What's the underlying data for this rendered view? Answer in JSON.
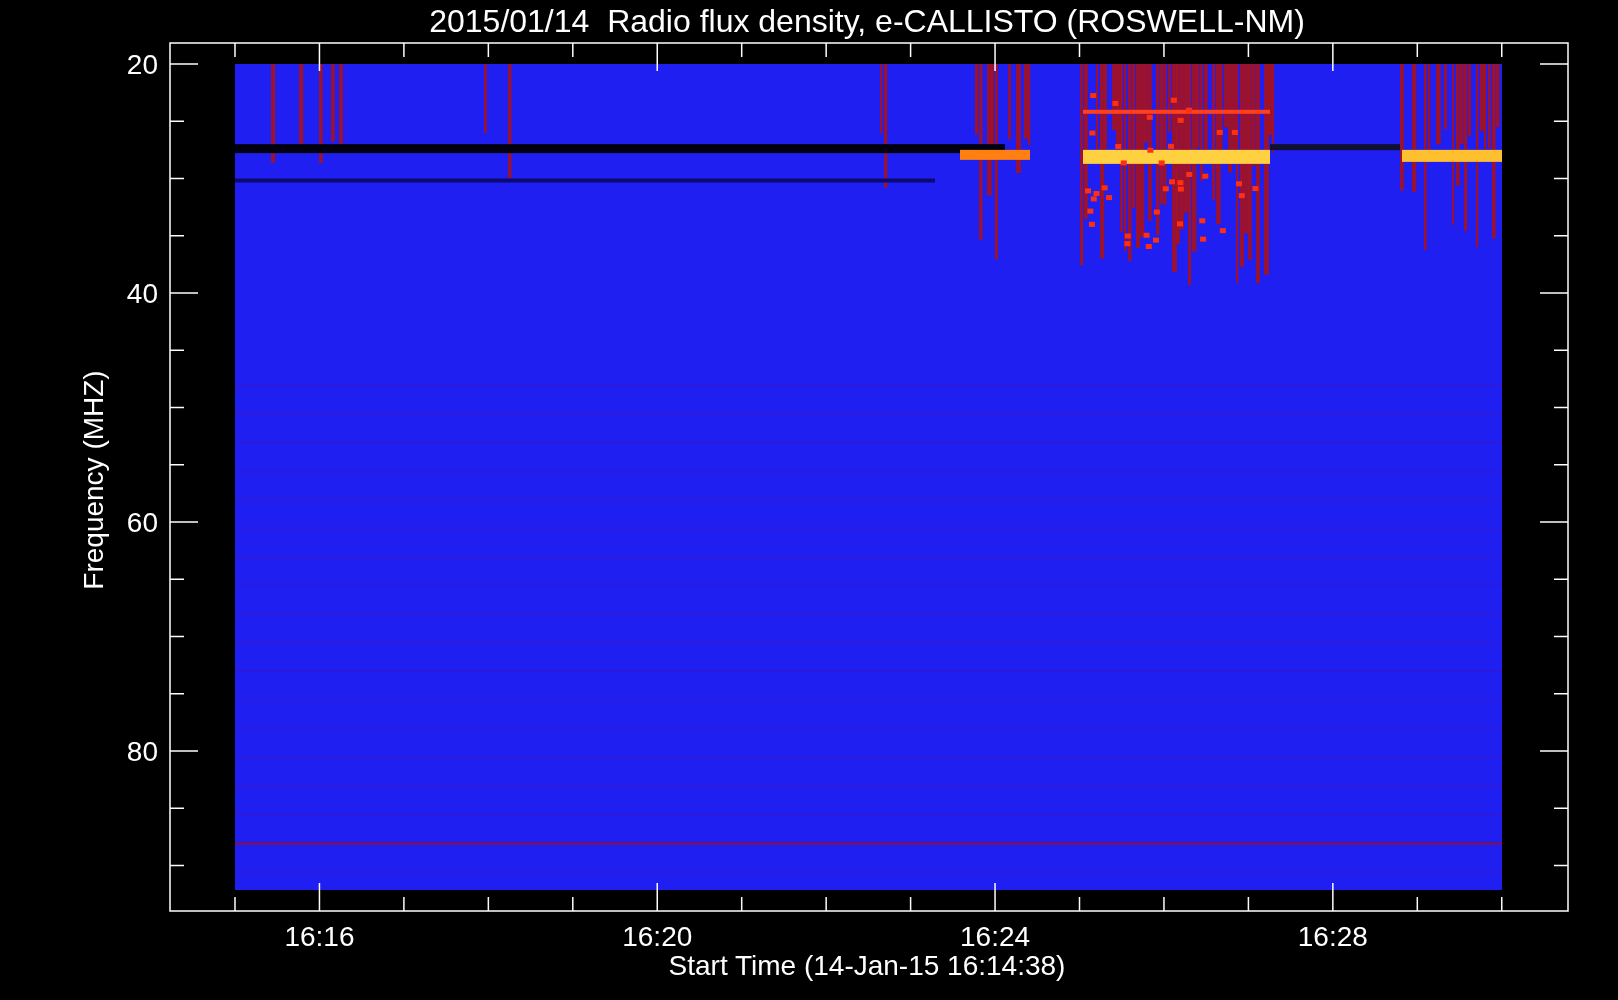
{
  "title": "2015/01/14  Radio flux density, e-CALLISTO (ROSWELL-NM)",
  "y_axis": {
    "label": "Frequency (MHZ)",
    "ticks": [
      "20",
      "40",
      "60",
      "80"
    ]
  },
  "x_axis": {
    "label": "Start Time (14-Jan-15 16:14:38)",
    "ticks": [
      "16:16",
      "16:20",
      "16:24",
      "16:28"
    ]
  }
}
